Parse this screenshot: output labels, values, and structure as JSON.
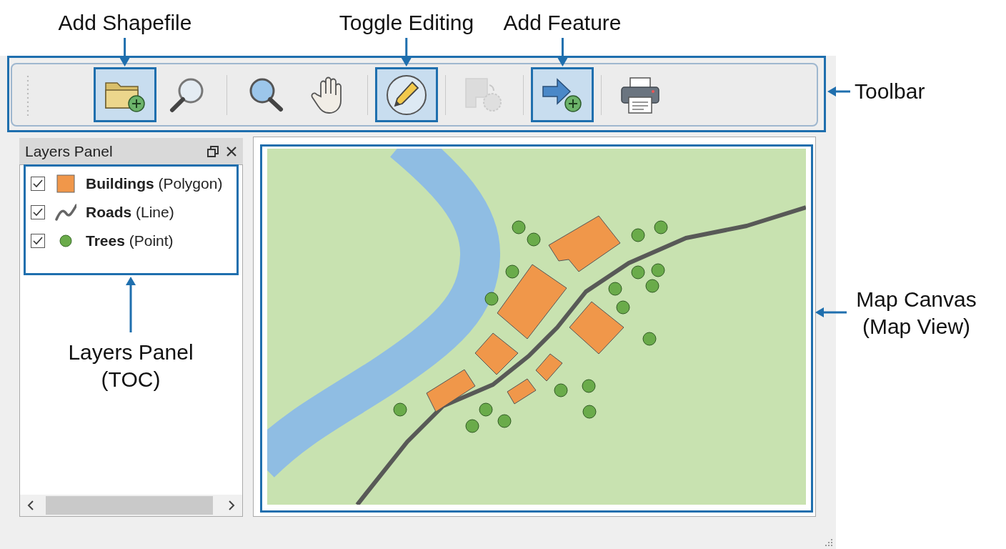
{
  "toolbar": {
    "label": "Toolbar",
    "tools": [
      {
        "kind": "button",
        "highlighted": true,
        "disabled": false,
        "callout": "Add Shapefile"
      },
      {
        "kind": "button",
        "highlighted": false,
        "disabled": false
      },
      {
        "kind": "separator"
      },
      {
        "kind": "button",
        "highlighted": false,
        "disabled": false
      },
      {
        "kind": "button",
        "highlighted": false,
        "disabled": false
      },
      {
        "kind": "separator"
      },
      {
        "kind": "button",
        "highlighted": true,
        "disabled": false,
        "callout": "Toggle Editing"
      },
      {
        "kind": "separator"
      },
      {
        "kind": "button",
        "highlighted": false,
        "disabled": true
      },
      {
        "kind": "separator"
      },
      {
        "kind": "button",
        "highlighted": true,
        "disabled": false,
        "callout": "Add Feature"
      },
      {
        "kind": "separator"
      },
      {
        "kind": "button",
        "highlighted": false,
        "disabled": false
      }
    ]
  },
  "layers_panel": {
    "title": "Layers Panel",
    "callout": "Layers Panel\n(TOC)",
    "layers": [
      {
        "label": "**Buildings** (Polygon)",
        "kind": "polygon",
        "checked": true,
        "color": "#f0974a"
      },
      {
        "label": "**Roads** (Line)",
        "kind": "line",
        "checked": true,
        "color": "#666666"
      },
      {
        "label": "**Trees** (Point)",
        "kind": "point",
        "checked": true,
        "color": "#6aab4a"
      }
    ]
  },
  "map_canvas": {
    "callout": "Map Canvas\n(Map View)"
  }
}
